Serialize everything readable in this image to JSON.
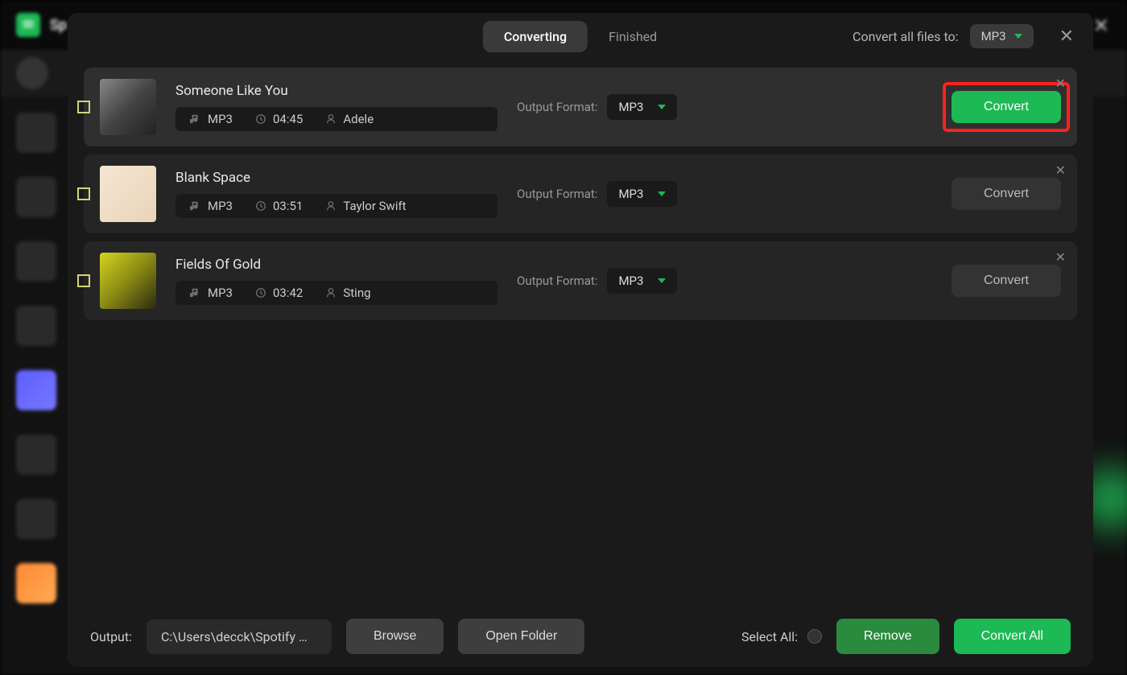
{
  "bg": {
    "title": "Sp"
  },
  "header": {
    "tabs": {
      "converting": "Converting",
      "finished": "Finished"
    },
    "convert_all_label": "Convert all files to:",
    "global_format": "MP3"
  },
  "tracks": [
    {
      "title": "Someone Like You",
      "format": "MP3",
      "duration": "04:45",
      "artist": "Adele",
      "output_label": "Output Format:",
      "output_format": "MP3",
      "convert_label": "Convert",
      "highlighted": true,
      "primary": true
    },
    {
      "title": "Blank Space",
      "format": "MP3",
      "duration": "03:51",
      "artist": "Taylor Swift",
      "output_label": "Output Format:",
      "output_format": "MP3",
      "convert_label": "Convert",
      "highlighted": false,
      "primary": false
    },
    {
      "title": "Fields Of Gold",
      "format": "MP3",
      "duration": "03:42",
      "artist": "Sting",
      "output_label": "Output Format:",
      "output_format": "MP3",
      "convert_label": "Convert",
      "highlighted": false,
      "primary": false
    }
  ],
  "footer": {
    "output_label": "Output:",
    "output_path": "C:\\Users\\decck\\Spotify M…",
    "browse": "Browse",
    "open_folder": "Open Folder",
    "select_all": "Select All:",
    "remove": "Remove",
    "convert_all": "Convert All"
  }
}
